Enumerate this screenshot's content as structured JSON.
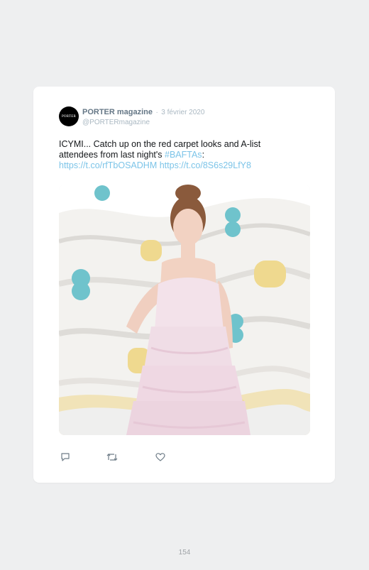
{
  "tweet": {
    "avatar_text": "PORTER",
    "display_name": "PORTER magazine",
    "separator": "·",
    "date": "3 février 2020",
    "handle": "@PORTERmagazine",
    "text_line1": "ICYMI... Catch up on the red carpet looks and A-list",
    "text_line2_prefix": "attendees from last night's ",
    "hashtag": "#BAFTAs",
    "text_line2_suffix": ":",
    "link1": "https://t.co/rfTbOSADHM",
    "link2": "https://t.co/8S6s29LfY8",
    "media_icon": "photo-red-carpet",
    "actions": {
      "reply_icon": "reply-icon",
      "retweet_icon": "retweet-icon",
      "like_icon": "heart-icon"
    }
  },
  "colors": {
    "background": "#eeeff0",
    "card": "#ffffff",
    "link": "#7cc4e8",
    "muted": "#aab8c2"
  },
  "page": {
    "number": "154"
  }
}
